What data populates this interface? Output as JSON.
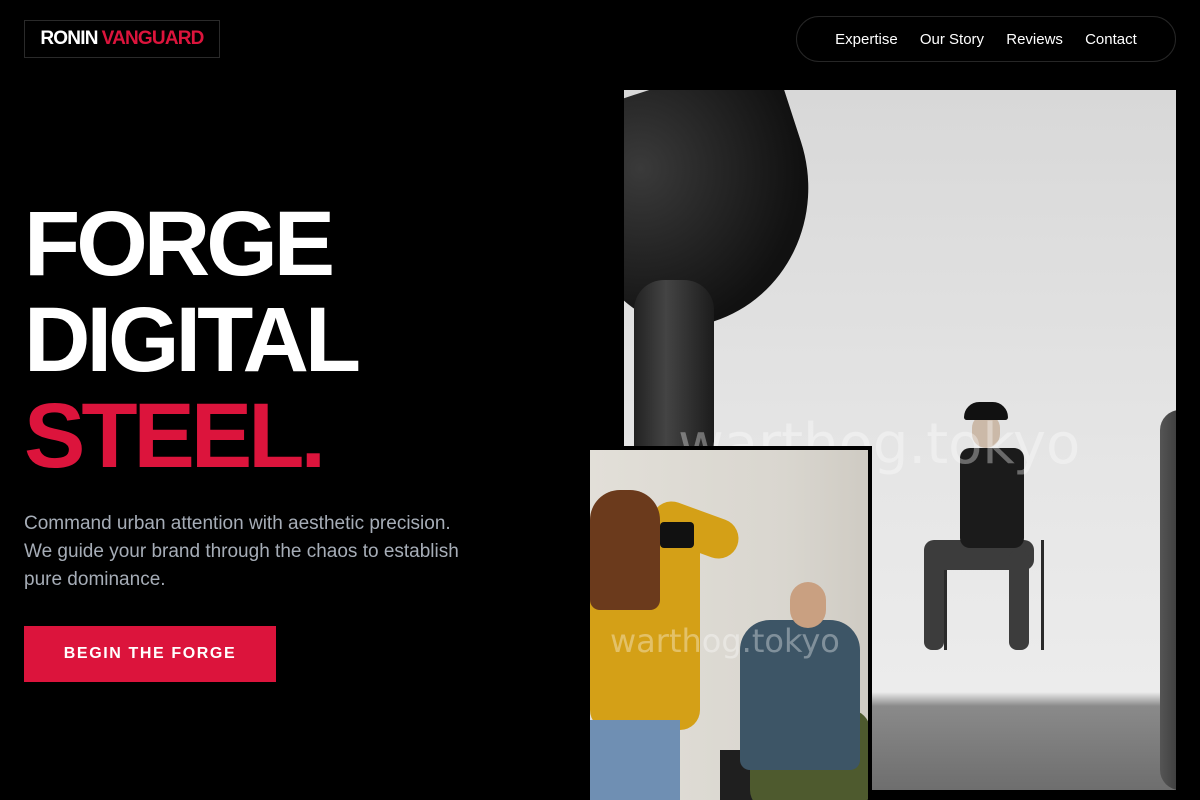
{
  "brand": {
    "first": "RONIN",
    "second": "VANGUARD"
  },
  "nav": {
    "items": [
      {
        "label": "Expertise"
      },
      {
        "label": "Our Story"
      },
      {
        "label": "Reviews"
      },
      {
        "label": "Contact"
      }
    ]
  },
  "hero": {
    "line1": "FORGE",
    "line2": "DIGITAL",
    "line3": "STEEL.",
    "subtitle": "Command urban attention with aesthetic precision. We guide your brand through the chaos to establish pure dominance.",
    "cta_label": "BEGIN THE FORGE"
  },
  "photos": {
    "watermark_main": "warthog.tokyo",
    "watermark_inset": "warthog.tokyo"
  },
  "colors": {
    "accent": "#dc143c",
    "background": "#000000",
    "subtitle": "#a6adb7"
  }
}
